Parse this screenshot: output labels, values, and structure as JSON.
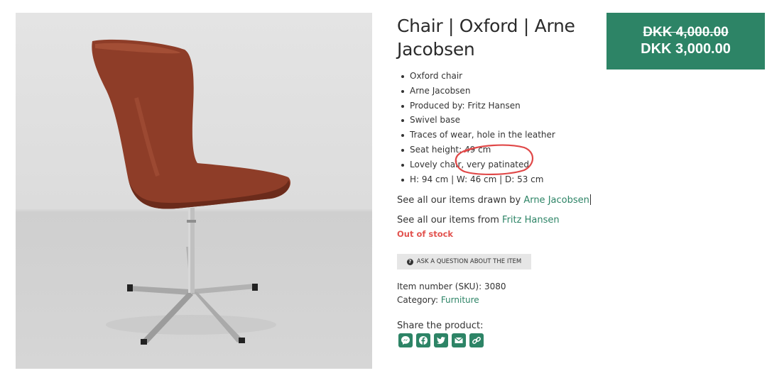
{
  "product": {
    "title": "Chair | Oxford | Arne Jacobsen",
    "price_old": "DKK 4,000.00",
    "price_new": "DKK 3,000.00",
    "features": [
      "Oxford chair",
      "Arne Jacobsen",
      "Produced by: Fritz Hansen",
      "Swivel base",
      "Traces of wear, hole in the leather",
      "Seat height: 49 cm",
      "Lovely chair, very patinated",
      "H: 94 cm | W: 46 cm | D: 53 cm"
    ],
    "see_designer_prefix": "See all our items drawn by",
    "designer_link": "Arne Jacobsen",
    "see_maker_prefix": "See all our items from",
    "maker_link": "Fritz Hansen",
    "stock_status": "Out of stock",
    "ask_button": "ASK A QUESTION ABOUT THE ITEM",
    "sku_label": "Item number (SKU): 3080",
    "category_label": "Category:",
    "category_link": "Furniture",
    "share_label": "Share the product:",
    "share_icons": [
      "messenger-icon",
      "facebook-icon",
      "twitter-icon",
      "email-icon",
      "copy-link-icon"
    ]
  },
  "colors": {
    "accent": "#2d8466",
    "out_of_stock": "#e2534f",
    "annotation": "#e04848",
    "leather": "#8e3d28"
  }
}
